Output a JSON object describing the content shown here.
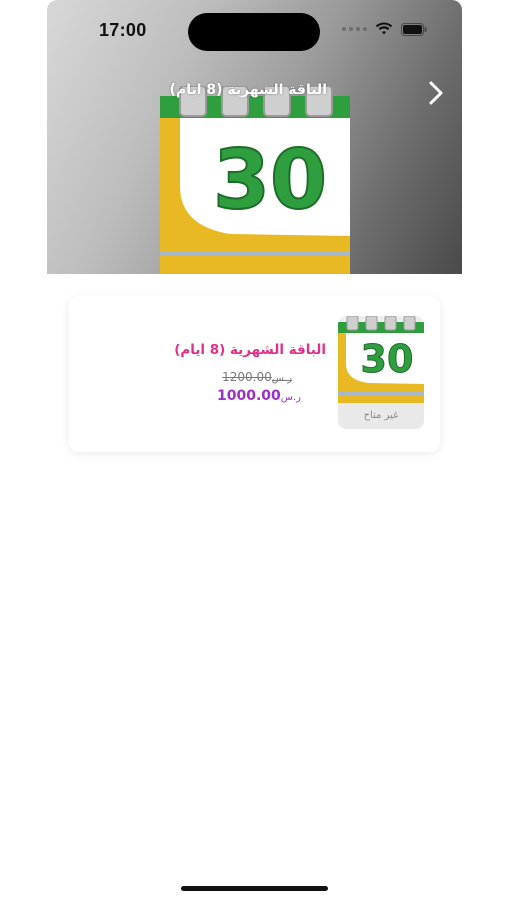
{
  "status_bar": {
    "time": "17:00",
    "wifi_icon": "wifi-icon",
    "battery_icon": "battery-icon"
  },
  "header": {
    "title": "الباقة الشهرية (8 ايام)",
    "back_icon": "chevron-right-icon",
    "image_number": "30"
  },
  "package": {
    "name": "الباقة الشهرية (8 ايام)",
    "old_price": "1200.00",
    "old_currency": "ر.س",
    "new_price": "1000.00",
    "new_currency": "ر.س",
    "thumb_number": "30",
    "availability": "غير متاح"
  },
  "colors": {
    "name": "#e0308a",
    "new_price": "#9b2fc6",
    "calendar_green": "#2e9e3e",
    "calendar_yellow": "#e8b923"
  }
}
